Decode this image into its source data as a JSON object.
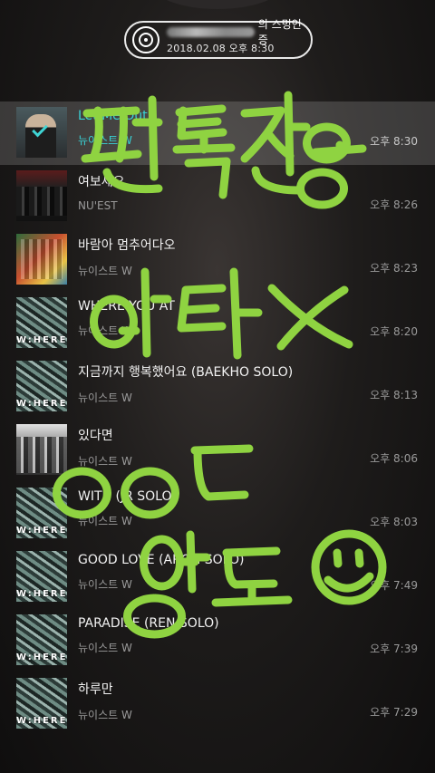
{
  "badge": {
    "title_suffix": "의 스밍인증",
    "timestamp": "2018.02.08 오후 8:30",
    "icon": "disc-icon"
  },
  "tracks": [
    {
      "title": "Let Me Out",
      "artist": "뉴이스트 W",
      "time": "오후 8:30",
      "art": "person",
      "selected": true
    },
    {
      "title": "여보세요",
      "artist": "NU'EST",
      "time": "오후 8:26",
      "art": "dark"
    },
    {
      "title": "바람아 멈추어다오",
      "artist": "뉴이스트 W",
      "time": "오후 8:23",
      "art": "color"
    },
    {
      "title": "WHERE YOU AT",
      "artist": "뉴이스트 W",
      "time": "오후 8:20",
      "art": "where"
    },
    {
      "title": "지금까지 행복했어요 (BAEKHO SOLO)",
      "artist": "뉴이스트 W",
      "time": "오후 8:13",
      "art": "where"
    },
    {
      "title": "있다면",
      "artist": "뉴이스트 W",
      "time": "오후 8:06",
      "art": "gray"
    },
    {
      "title": "WITH (JR SOLO)",
      "artist": "뉴이스트 W",
      "time": "오후 8:03",
      "art": "where"
    },
    {
      "title": "GOOD LOVE (ARON SOLO)",
      "artist": "뉴이스트 W",
      "time": "오후 7:49",
      "art": "where"
    },
    {
      "title": "PARADISE (REN SOLO)",
      "artist": "뉴이스트 W",
      "time": "오후 7:39",
      "art": "where"
    },
    {
      "title": "하루만",
      "artist": "뉴이스트 W",
      "time": "오후 7:29",
      "art": "where"
    }
  ],
  "album_label": "W:HERE",
  "overlay_text": [
    "팬톡전용",
    "ㅇㅇㄷ",
    "양도"
  ],
  "colors": {
    "accent": "#39d2d6",
    "handwriting": "#8fd341"
  }
}
